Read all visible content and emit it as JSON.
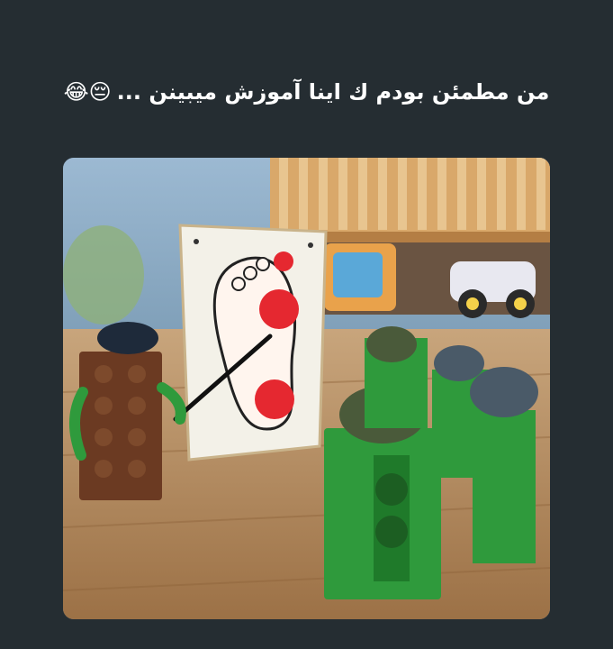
{
  "post": {
    "caption_text": "من مطمئن بودم ك اینا آموزش میبینن ...",
    "caption_emojis": "😔😂",
    "image": {
      "icon": "lego-soldiers-foot-chart-photo",
      "colors": {
        "background": "#252d32",
        "floor": "#b58a5a",
        "lego_green": "#2f9a3c",
        "lego_brown": "#6b3a22",
        "helmet": "#4a5a68",
        "foot_dots": "#e52830"
      }
    }
  }
}
